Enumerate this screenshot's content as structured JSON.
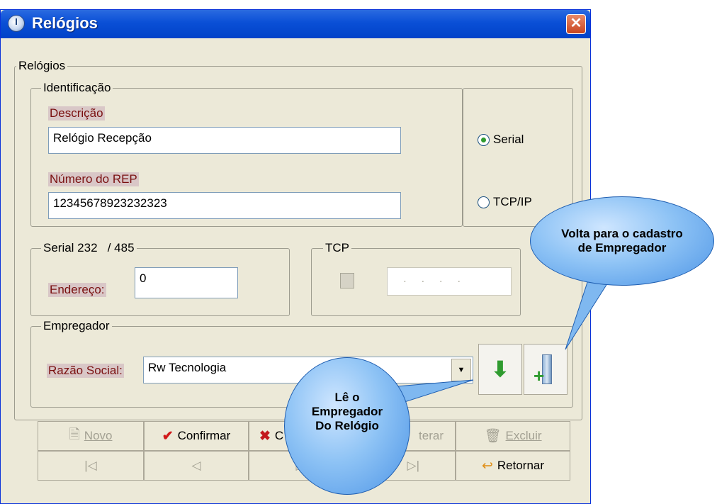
{
  "window": {
    "title": "Relógios"
  },
  "main_group": {
    "legend": "Relógios"
  },
  "identificacao": {
    "legend": "Identificação",
    "descricao_label": "Descrição",
    "descricao_value": "Relógio Recepção",
    "numero_label": "Número do REP",
    "numero_value": "12345678923232323"
  },
  "connection": {
    "serial_label": "Serial",
    "tcpip_label": "TCP/IP",
    "selected": "Serial"
  },
  "serial_group": {
    "legend": "Serial 232   / 485",
    "endereco_label": "Endereço:",
    "endereco_value": "0"
  },
  "tcp_group": {
    "legend": "TCP",
    "ip_value": ". . . ."
  },
  "empregador": {
    "legend": "Empregador",
    "razao_label": "Razão Social:",
    "razao_value": "Rw Tecnologia"
  },
  "buttons": {
    "novo": "Novo",
    "confirmar": "Confirmar",
    "cancelar": "C",
    "alterar": "terar",
    "excluir": "Excluir",
    "retornar": "Retornar"
  },
  "callouts": {
    "top_line1": "Volta para o cadastro",
    "top_line2": "de Empregador",
    "bottom_line1": "Lê o",
    "bottom_line2": "Empregador",
    "bottom_line3": "Do Relógio"
  },
  "icons": {
    "title": "clock-icon",
    "close": "close-icon",
    "read_employer": "download-arrow-icon",
    "employer_register": "building-add-icon"
  },
  "colors": {
    "titlebar": "#0a4fd6",
    "window_bg": "#ece9d8",
    "callout": "#8ec3f5",
    "label_text": "#7a1010"
  }
}
